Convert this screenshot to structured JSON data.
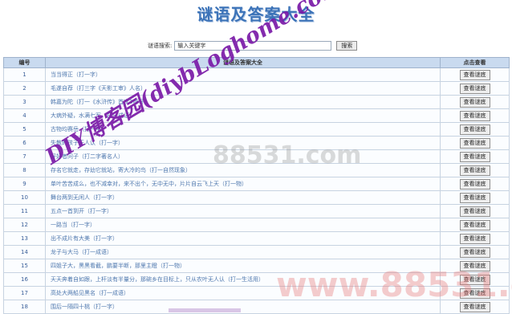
{
  "page": {
    "title": "谜语及答案大全"
  },
  "search": {
    "label": "谜语搜索:",
    "placeholder": "输入关键字",
    "button": "搜索"
  },
  "table": {
    "headers": {
      "num": "编号",
      "content": "谜语及答案大全",
      "action": "点击查看"
    },
    "view_label": "查看谜底",
    "rows": [
      {
        "num": "1",
        "text": "当当得正（打一字）"
      },
      {
        "num": "2",
        "text": "毛遂自荐（打三字《天影工审》人名）"
      },
      {
        "num": "3",
        "text": "韩嘉为陀（打一《水浒传》首次3绰号）"
      },
      {
        "num": "4",
        "text": "大病外疑，水满七军（打一成语）"
      },
      {
        "num": "5",
        "text": "古物均赛岳（打一字）"
      },
      {
        "num": "6",
        "text": "失散的孩子无人认（打一字）"
      },
      {
        "num": "7",
        "text": "好好者问子（打二字著名人）"
      },
      {
        "num": "8",
        "text": "存名它就走，存幼它就站，寄大冷的鸟（打一自然现象）"
      },
      {
        "num": "9",
        "text": "单叶苦苦成么，也不减幸对，来不出个，无中无中，片片自云飞上天（打一物）"
      },
      {
        "num": "10",
        "text": "舞台两到无闲人（打一字）"
      },
      {
        "num": "11",
        "text": "五点一首到开（打一字）"
      },
      {
        "num": "12",
        "text": "一路当（打一字）"
      },
      {
        "num": "13",
        "text": "出不成片有大美（打一字）"
      },
      {
        "num": "14",
        "text": "龙子与大马（打一成语）"
      },
      {
        "num": "15",
        "text": "四姐子大，黑黑看截，鹏要半断，那里主瞪（打一物）"
      },
      {
        "num": "16",
        "text": "天天奔着自如跟，上杆淡有半量分，那碗乡在目标上，只从农叶无人认（打一生活用）"
      },
      {
        "num": "17",
        "text": "高处大两船见黑名（打一成语）"
      },
      {
        "num": "18",
        "text": "围后一隔四十桃（打一字）"
      }
    ]
  },
  "watermark": {
    "main": "DIY博客园(diybLoghome.com)",
    "faint_mid": "88531.com",
    "faint_bottom": "www.88531.cn"
  }
}
